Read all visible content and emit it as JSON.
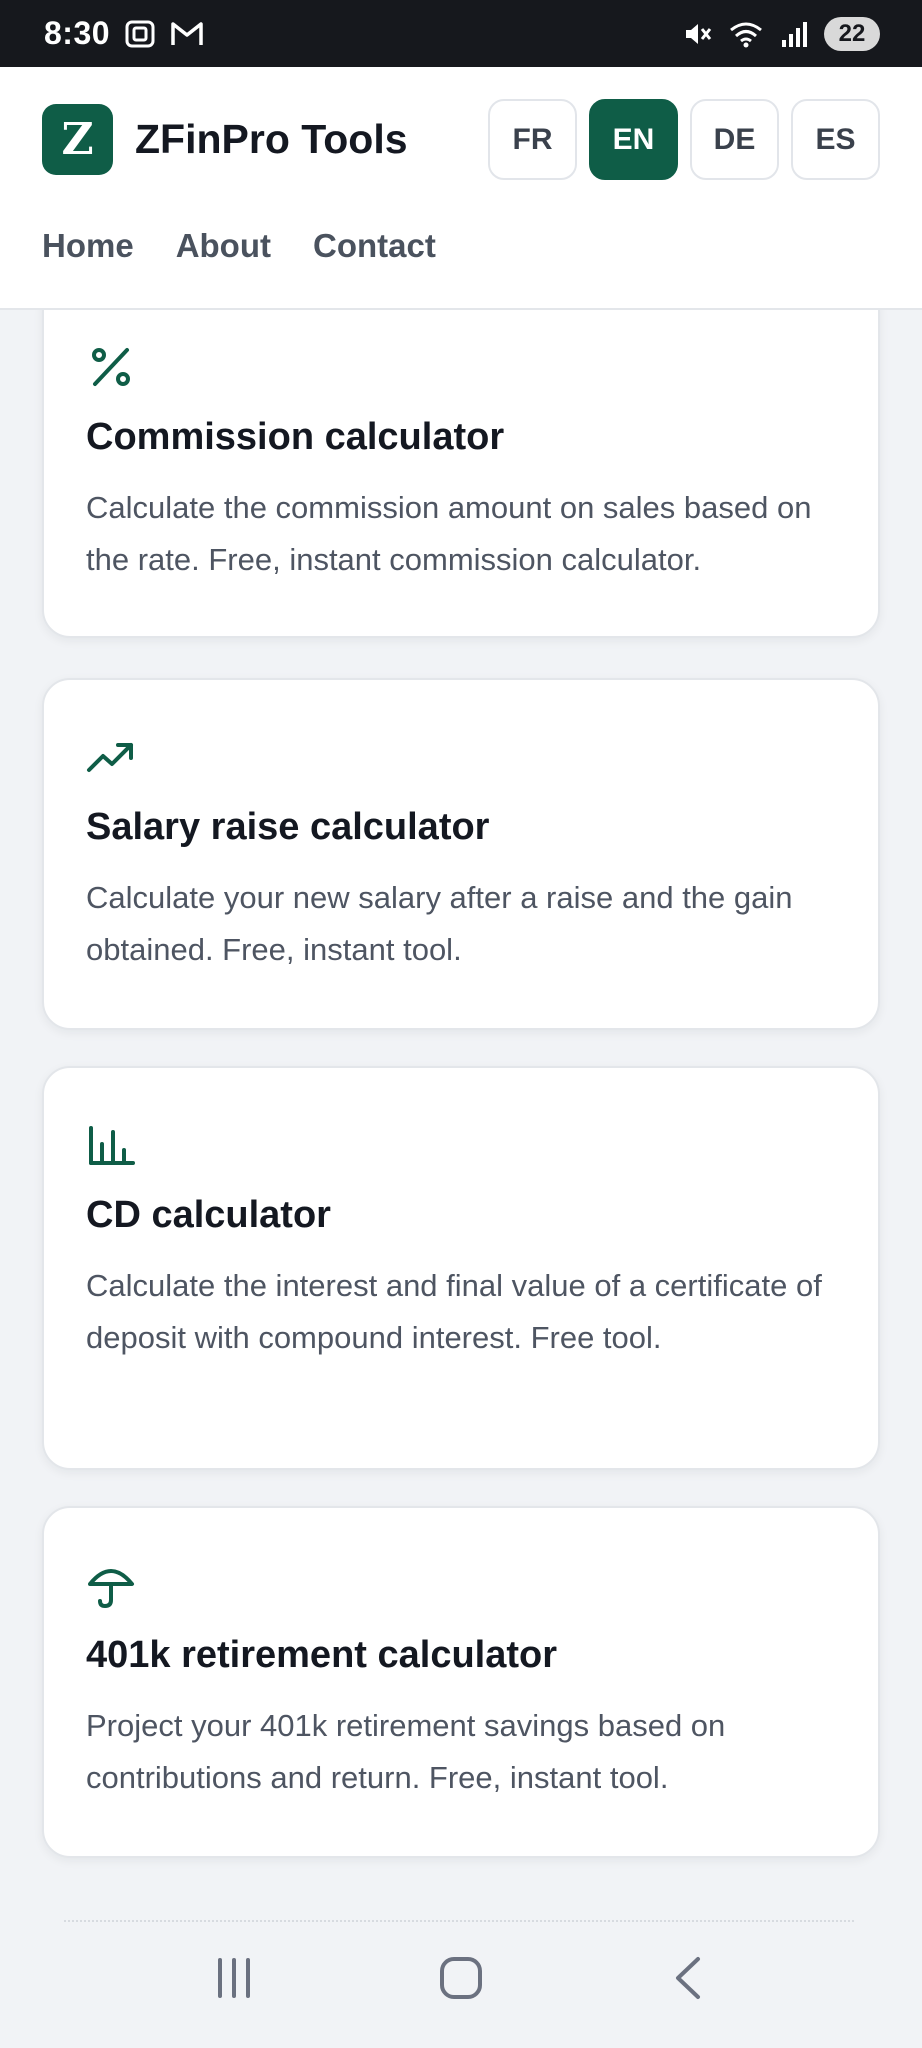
{
  "status_bar": {
    "time": "8:30",
    "battery": "22",
    "icons": [
      "screenshot-icon",
      "gmail-icon",
      "mute-icon",
      "wifi-icon",
      "signal-icon"
    ]
  },
  "header": {
    "logo_letter": "Z",
    "brand": "ZFinPro Tools",
    "languages": [
      {
        "code": "FR",
        "active": false
      },
      {
        "code": "EN",
        "active": true
      },
      {
        "code": "DE",
        "active": false
      },
      {
        "code": "ES",
        "active": false
      }
    ],
    "nav": [
      "Home",
      "About",
      "Contact"
    ]
  },
  "cards": [
    {
      "icon": "percent-icon",
      "title": "Commission calculator",
      "description": "Calculate the commission amount on sales based on the rate. Free, instant commission calculator."
    },
    {
      "icon": "trending-up-icon",
      "title": "Salary raise calculator",
      "description": "Calculate your new salary after a raise and the gain obtained. Free, instant tool."
    },
    {
      "icon": "bar-chart-icon",
      "title": "CD calculator",
      "description": "Calculate the interest and final value of a certificate of deposit with compound interest. Free tool."
    },
    {
      "icon": "umbrella-icon",
      "title": "401k retirement calculator",
      "description": "Project your 401k retirement savings based on contributions and return. Free, instant tool."
    }
  ],
  "system_nav": [
    "recent-apps-icon",
    "home-icon",
    "back-icon"
  ],
  "colors": {
    "accent": "#0f5d47",
    "text": "#141821",
    "muted": "#4e5562",
    "background": "#f1f3f6"
  }
}
